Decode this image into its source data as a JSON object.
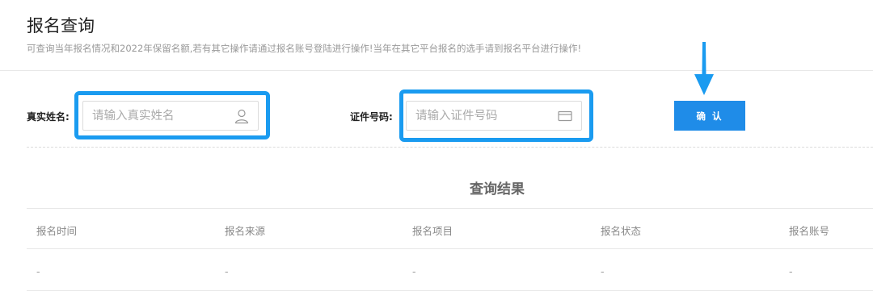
{
  "header": {
    "title": "报名查询",
    "description": "可查询当年报名情况和2022年保留名额,若有其它操作请通过报名账号登陆进行操作!当年在其它平台报名的选手请到报名平台进行操作!"
  },
  "form": {
    "name_label": "真实姓名:",
    "name_placeholder": "请输入真实姓名",
    "name_value": "",
    "name_icon": "user-icon",
    "id_label": "证件号码:",
    "id_placeholder": "请输入证件号码",
    "id_value": "",
    "id_icon": "id-card-icon",
    "confirm_label": "确 认"
  },
  "annotations": {
    "highlight_color": "#1a9bf0",
    "arrow_icon": "down-arrow-icon"
  },
  "results": {
    "title": "查询结果",
    "columns": [
      "报名时间",
      "报名来源",
      "报名项目",
      "报名状态",
      "报名账号"
    ],
    "rows": [
      [
        "-",
        "-",
        "-",
        "-",
        "-"
      ]
    ]
  },
  "colors": {
    "accent": "#1f8ce8",
    "highlight": "#1a9bf0"
  }
}
